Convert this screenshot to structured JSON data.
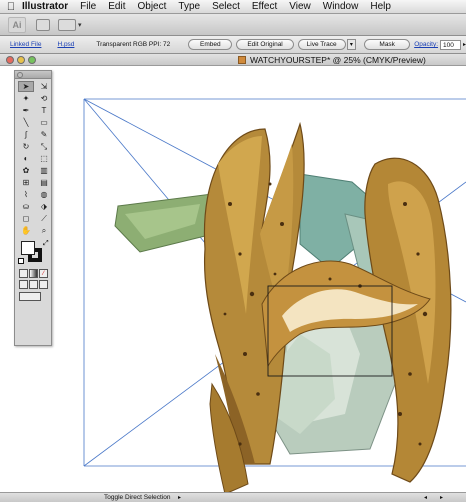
{
  "menubar": {
    "apple_icon": "apple-icon",
    "app_name": "Illustrator",
    "items": [
      "File",
      "Edit",
      "Object",
      "Type",
      "Select",
      "Effect",
      "View",
      "Window",
      "Help"
    ]
  },
  "appbar": {
    "logo_text": "Ai",
    "arrange_caret": "▾"
  },
  "controlbar": {
    "linked_file": "Linked File",
    "file_name": "H.psd",
    "image_info": "Transparent RGB  PPI: 72",
    "embed": "Embed",
    "edit_original": "Edit Original",
    "live_trace": "Live Trace",
    "live_trace_caret": "▾",
    "mask": "Mask",
    "opacity_label": "Opacity:",
    "opacity_value": "100",
    "opacity_caret": "▸"
  },
  "document": {
    "title": "WATCHYOURSTEP* @ 25% (CMYK/Preview)"
  },
  "tools": {
    "items": [
      {
        "name": "selection-tool",
        "glyph": "➤",
        "selected": true
      },
      {
        "name": "direct-selection-tool",
        "glyph": "⇲",
        "selected": false
      },
      {
        "name": "magic-wand-tool",
        "glyph": "✦",
        "selected": false
      },
      {
        "name": "lasso-tool",
        "glyph": "⟲",
        "selected": false
      },
      {
        "name": "pen-tool",
        "glyph": "✒",
        "selected": false
      },
      {
        "name": "type-tool",
        "glyph": "T",
        "selected": false
      },
      {
        "name": "line-tool",
        "glyph": "╲",
        "selected": false
      },
      {
        "name": "rectangle-tool",
        "glyph": "▭",
        "selected": false
      },
      {
        "name": "paintbrush-tool",
        "glyph": "∫",
        "selected": false
      },
      {
        "name": "pencil-tool",
        "glyph": "✎",
        "selected": false
      },
      {
        "name": "rotate-tool",
        "glyph": "↻",
        "selected": false
      },
      {
        "name": "scale-tool",
        "glyph": "⤡",
        "selected": false
      },
      {
        "name": "warp-tool",
        "glyph": "◐",
        "selected": false
      },
      {
        "name": "free-transform-tool",
        "glyph": "⬚",
        "selected": false
      },
      {
        "name": "symbol-sprayer-tool",
        "glyph": "✿",
        "selected": false
      },
      {
        "name": "column-graph-tool",
        "glyph": "▥",
        "selected": false
      },
      {
        "name": "mesh-tool",
        "glyph": "⊞",
        "selected": false
      },
      {
        "name": "gradient-tool",
        "glyph": "▤",
        "selected": false
      },
      {
        "name": "eyedropper-tool",
        "glyph": "⌇",
        "selected": false
      },
      {
        "name": "blend-tool",
        "glyph": "◍",
        "selected": false
      },
      {
        "name": "live-paint-bucket-tool",
        "glyph": "⛀",
        "selected": false
      },
      {
        "name": "live-paint-selection-tool",
        "glyph": "⬗",
        "selected": false
      },
      {
        "name": "artboard-tool",
        "glyph": "◻",
        "selected": false
      },
      {
        "name": "slice-tool",
        "glyph": "⟋",
        "selected": false
      },
      {
        "name": "hand-tool",
        "glyph": "✋",
        "selected": false
      },
      {
        "name": "zoom-tool",
        "glyph": "⌕",
        "selected": false
      }
    ]
  },
  "statusbar": {
    "tool_name": "Toggle Direct Selection",
    "arrow": "▸",
    "scroll_left": "◂",
    "scroll_right": "▸"
  }
}
